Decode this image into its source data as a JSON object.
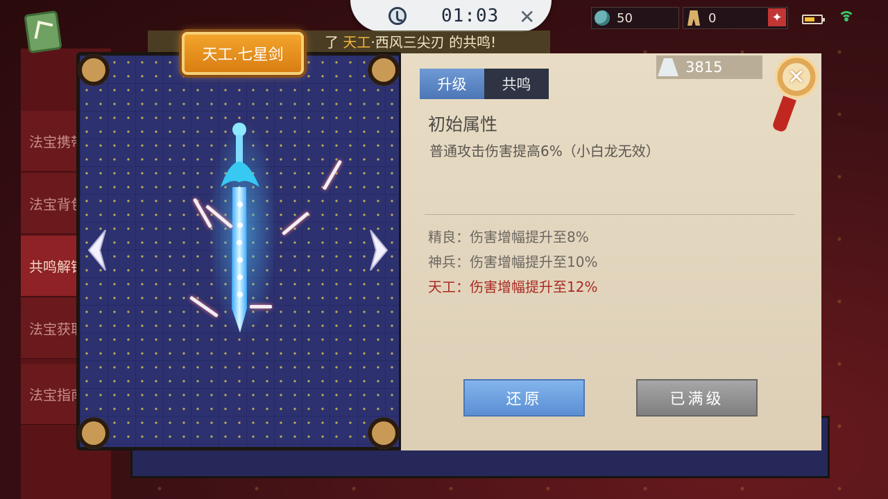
{
  "top_bar": {
    "timer": "01:03",
    "resource_1": "50",
    "resource_2": "0",
    "add_label": "+"
  },
  "notice": {
    "prefix": "了",
    "highlight": "天工",
    "rest": "·西风三尖刃 的共鸣!"
  },
  "side_tabs": [
    {
      "label": "法宝携带",
      "active": false
    },
    {
      "label": "法宝背包",
      "active": false
    },
    {
      "label": "共鸣解锁",
      "active": true
    },
    {
      "label": "法宝获取",
      "active": false
    },
    {
      "label": "法宝指南",
      "active": false
    }
  ],
  "item": {
    "name": "天工.七星剑"
  },
  "panel": {
    "tabs": [
      {
        "label": "升级",
        "active": true
      },
      {
        "label": "共鸣",
        "active": false
      }
    ],
    "currency_amount": "3815",
    "section_title": "初始属性",
    "base_effect": "普通攻击伤害提高6%（小白龙无效）",
    "tiers": [
      {
        "text": "精良：伤害增幅提升至8%",
        "highlight": false
      },
      {
        "text": "神兵：伤害增幅提升至10%",
        "highlight": false
      },
      {
        "text": "天工：伤害增幅提升至12%",
        "highlight": true
      }
    ],
    "restore_button": "还原",
    "max_button": "已满级"
  },
  "icons": {
    "clock": "clock-icon",
    "currency": "jade-tower-icon",
    "close": "close-icon"
  },
  "colors": {
    "accent_orange": "#e08b1c",
    "tier_highlight": "#a82a22",
    "tab_active": "#5a86c6"
  }
}
